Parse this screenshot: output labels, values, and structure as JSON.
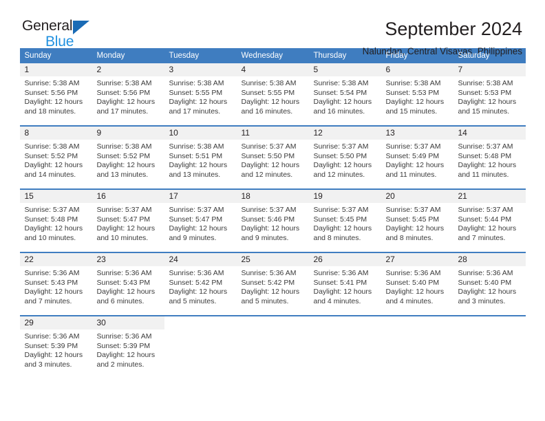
{
  "brand": {
    "word1": "General",
    "word2": "Blue",
    "triangle_color": "#1a6bb5",
    "blue_color": "#2191e0"
  },
  "header": {
    "title": "September 2024",
    "subtitle": "Nalundan, Central Visayas, Philippines"
  },
  "theme": {
    "header_blue": "#3f7dc0",
    "day_band_gray": "#f1f1f1",
    "text": "#231f20"
  },
  "weekday_headers": [
    "Sunday",
    "Monday",
    "Tuesday",
    "Wednesday",
    "Thursday",
    "Friday",
    "Saturday"
  ],
  "weeks": [
    [
      {
        "day": "1",
        "sunrise": "Sunrise: 5:38 AM",
        "sunset": "Sunset: 5:56 PM",
        "daylight1": "Daylight: 12 hours",
        "daylight2": "and 18 minutes."
      },
      {
        "day": "2",
        "sunrise": "Sunrise: 5:38 AM",
        "sunset": "Sunset: 5:56 PM",
        "daylight1": "Daylight: 12 hours",
        "daylight2": "and 17 minutes."
      },
      {
        "day": "3",
        "sunrise": "Sunrise: 5:38 AM",
        "sunset": "Sunset: 5:55 PM",
        "daylight1": "Daylight: 12 hours",
        "daylight2": "and 17 minutes."
      },
      {
        "day": "4",
        "sunrise": "Sunrise: 5:38 AM",
        "sunset": "Sunset: 5:55 PM",
        "daylight1": "Daylight: 12 hours",
        "daylight2": "and 16 minutes."
      },
      {
        "day": "5",
        "sunrise": "Sunrise: 5:38 AM",
        "sunset": "Sunset: 5:54 PM",
        "daylight1": "Daylight: 12 hours",
        "daylight2": "and 16 minutes."
      },
      {
        "day": "6",
        "sunrise": "Sunrise: 5:38 AM",
        "sunset": "Sunset: 5:53 PM",
        "daylight1": "Daylight: 12 hours",
        "daylight2": "and 15 minutes."
      },
      {
        "day": "7",
        "sunrise": "Sunrise: 5:38 AM",
        "sunset": "Sunset: 5:53 PM",
        "daylight1": "Daylight: 12 hours",
        "daylight2": "and 15 minutes."
      }
    ],
    [
      {
        "day": "8",
        "sunrise": "Sunrise: 5:38 AM",
        "sunset": "Sunset: 5:52 PM",
        "daylight1": "Daylight: 12 hours",
        "daylight2": "and 14 minutes."
      },
      {
        "day": "9",
        "sunrise": "Sunrise: 5:38 AM",
        "sunset": "Sunset: 5:52 PM",
        "daylight1": "Daylight: 12 hours",
        "daylight2": "and 13 minutes."
      },
      {
        "day": "10",
        "sunrise": "Sunrise: 5:38 AM",
        "sunset": "Sunset: 5:51 PM",
        "daylight1": "Daylight: 12 hours",
        "daylight2": "and 13 minutes."
      },
      {
        "day": "11",
        "sunrise": "Sunrise: 5:37 AM",
        "sunset": "Sunset: 5:50 PM",
        "daylight1": "Daylight: 12 hours",
        "daylight2": "and 12 minutes."
      },
      {
        "day": "12",
        "sunrise": "Sunrise: 5:37 AM",
        "sunset": "Sunset: 5:50 PM",
        "daylight1": "Daylight: 12 hours",
        "daylight2": "and 12 minutes."
      },
      {
        "day": "13",
        "sunrise": "Sunrise: 5:37 AM",
        "sunset": "Sunset: 5:49 PM",
        "daylight1": "Daylight: 12 hours",
        "daylight2": "and 11 minutes."
      },
      {
        "day": "14",
        "sunrise": "Sunrise: 5:37 AM",
        "sunset": "Sunset: 5:48 PM",
        "daylight1": "Daylight: 12 hours",
        "daylight2": "and 11 minutes."
      }
    ],
    [
      {
        "day": "15",
        "sunrise": "Sunrise: 5:37 AM",
        "sunset": "Sunset: 5:48 PM",
        "daylight1": "Daylight: 12 hours",
        "daylight2": "and 10 minutes."
      },
      {
        "day": "16",
        "sunrise": "Sunrise: 5:37 AM",
        "sunset": "Sunset: 5:47 PM",
        "daylight1": "Daylight: 12 hours",
        "daylight2": "and 10 minutes."
      },
      {
        "day": "17",
        "sunrise": "Sunrise: 5:37 AM",
        "sunset": "Sunset: 5:47 PM",
        "daylight1": "Daylight: 12 hours",
        "daylight2": "and 9 minutes."
      },
      {
        "day": "18",
        "sunrise": "Sunrise: 5:37 AM",
        "sunset": "Sunset: 5:46 PM",
        "daylight1": "Daylight: 12 hours",
        "daylight2": "and 9 minutes."
      },
      {
        "day": "19",
        "sunrise": "Sunrise: 5:37 AM",
        "sunset": "Sunset: 5:45 PM",
        "daylight1": "Daylight: 12 hours",
        "daylight2": "and 8 minutes."
      },
      {
        "day": "20",
        "sunrise": "Sunrise: 5:37 AM",
        "sunset": "Sunset: 5:45 PM",
        "daylight1": "Daylight: 12 hours",
        "daylight2": "and 8 minutes."
      },
      {
        "day": "21",
        "sunrise": "Sunrise: 5:37 AM",
        "sunset": "Sunset: 5:44 PM",
        "daylight1": "Daylight: 12 hours",
        "daylight2": "and 7 minutes."
      }
    ],
    [
      {
        "day": "22",
        "sunrise": "Sunrise: 5:36 AM",
        "sunset": "Sunset: 5:43 PM",
        "daylight1": "Daylight: 12 hours",
        "daylight2": "and 7 minutes."
      },
      {
        "day": "23",
        "sunrise": "Sunrise: 5:36 AM",
        "sunset": "Sunset: 5:43 PM",
        "daylight1": "Daylight: 12 hours",
        "daylight2": "and 6 minutes."
      },
      {
        "day": "24",
        "sunrise": "Sunrise: 5:36 AM",
        "sunset": "Sunset: 5:42 PM",
        "daylight1": "Daylight: 12 hours",
        "daylight2": "and 5 minutes."
      },
      {
        "day": "25",
        "sunrise": "Sunrise: 5:36 AM",
        "sunset": "Sunset: 5:42 PM",
        "daylight1": "Daylight: 12 hours",
        "daylight2": "and 5 minutes."
      },
      {
        "day": "26",
        "sunrise": "Sunrise: 5:36 AM",
        "sunset": "Sunset: 5:41 PM",
        "daylight1": "Daylight: 12 hours",
        "daylight2": "and 4 minutes."
      },
      {
        "day": "27",
        "sunrise": "Sunrise: 5:36 AM",
        "sunset": "Sunset: 5:40 PM",
        "daylight1": "Daylight: 12 hours",
        "daylight2": "and 4 minutes."
      },
      {
        "day": "28",
        "sunrise": "Sunrise: 5:36 AM",
        "sunset": "Sunset: 5:40 PM",
        "daylight1": "Daylight: 12 hours",
        "daylight2": "and 3 minutes."
      }
    ],
    [
      {
        "day": "29",
        "sunrise": "Sunrise: 5:36 AM",
        "sunset": "Sunset: 5:39 PM",
        "daylight1": "Daylight: 12 hours",
        "daylight2": "and 3 minutes."
      },
      {
        "day": "30",
        "sunrise": "Sunrise: 5:36 AM",
        "sunset": "Sunset: 5:39 PM",
        "daylight1": "Daylight: 12 hours",
        "daylight2": "and 2 minutes."
      },
      {
        "day": "",
        "sunrise": "",
        "sunset": "",
        "daylight1": "",
        "daylight2": ""
      },
      {
        "day": "",
        "sunrise": "",
        "sunset": "",
        "daylight1": "",
        "daylight2": ""
      },
      {
        "day": "",
        "sunrise": "",
        "sunset": "",
        "daylight1": "",
        "daylight2": ""
      },
      {
        "day": "",
        "sunrise": "",
        "sunset": "",
        "daylight1": "",
        "daylight2": ""
      },
      {
        "day": "",
        "sunrise": "",
        "sunset": "",
        "daylight1": "",
        "daylight2": ""
      }
    ]
  ]
}
